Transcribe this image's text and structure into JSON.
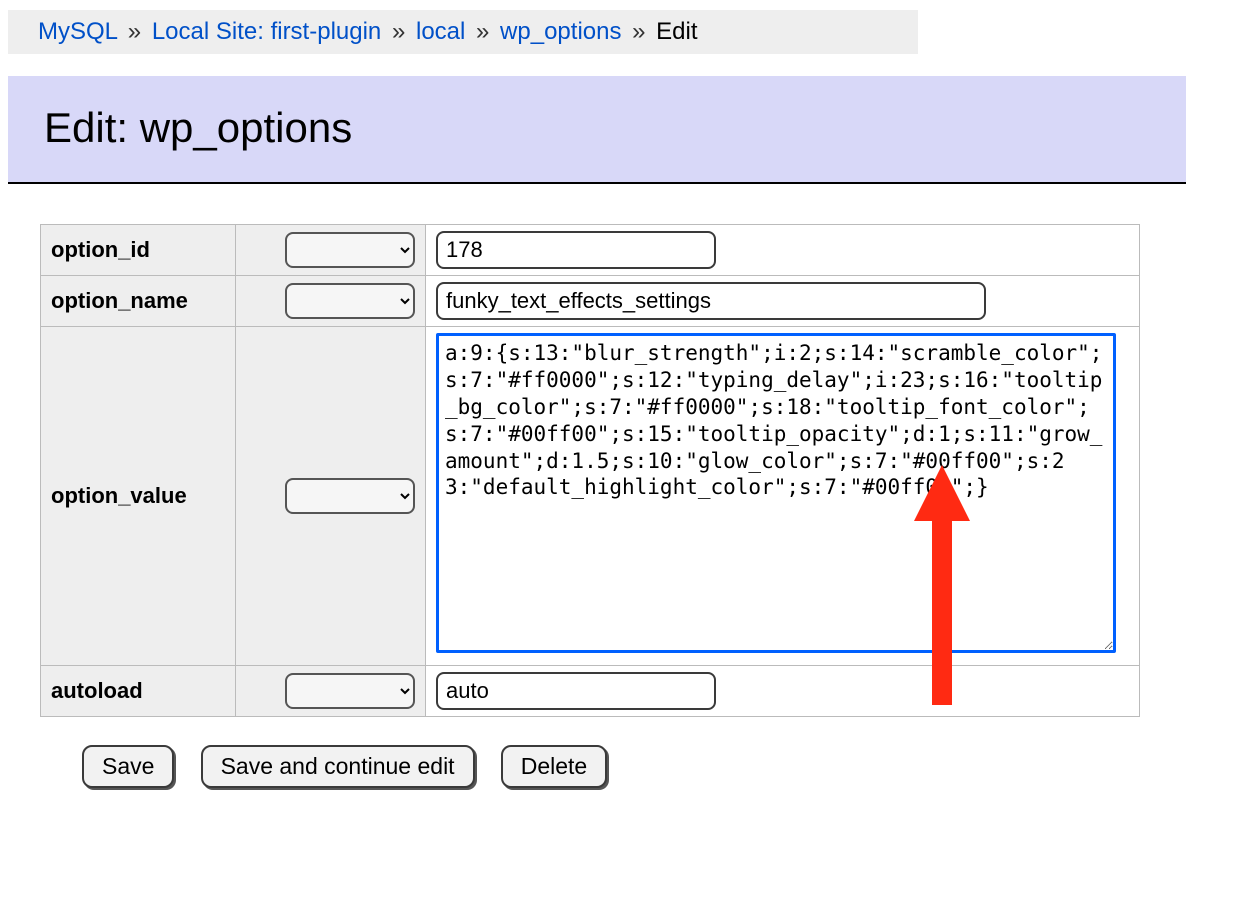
{
  "breadcrumb": {
    "items": [
      "MySQL",
      "Local Site: first-plugin",
      "local",
      "wp_options"
    ],
    "current": "Edit",
    "separator": "»"
  },
  "page_title": "Edit: wp_options",
  "fields": {
    "option_id": {
      "label": "option_id",
      "func": "",
      "value": "178"
    },
    "option_name": {
      "label": "option_name",
      "func": "",
      "value": "funky_text_effects_settings"
    },
    "option_value": {
      "label": "option_value",
      "func": "",
      "value": "a:9:{s:13:\"blur_strength\";i:2;s:14:\"scramble_color\";s:7:\"#ff0000\";s:12:\"typing_delay\";i:23;s:16:\"tooltip_bg_color\";s:7:\"#ff0000\";s:18:\"tooltip_font_color\";s:7:\"#00ff00\";s:15:\"tooltip_opacity\";d:1;s:11:\"grow_amount\";d:1.5;s:10:\"glow_color\";s:7:\"#00ff00\";s:23:\"default_highlight_color\";s:7:\"#00ff00\";}"
    },
    "autoload": {
      "label": "autoload",
      "func": "",
      "value": "auto"
    }
  },
  "buttons": {
    "save": "Save",
    "save_continue": "Save and continue edit",
    "delete": "Delete"
  },
  "annotation": {
    "arrow_color": "#ff2a12"
  }
}
